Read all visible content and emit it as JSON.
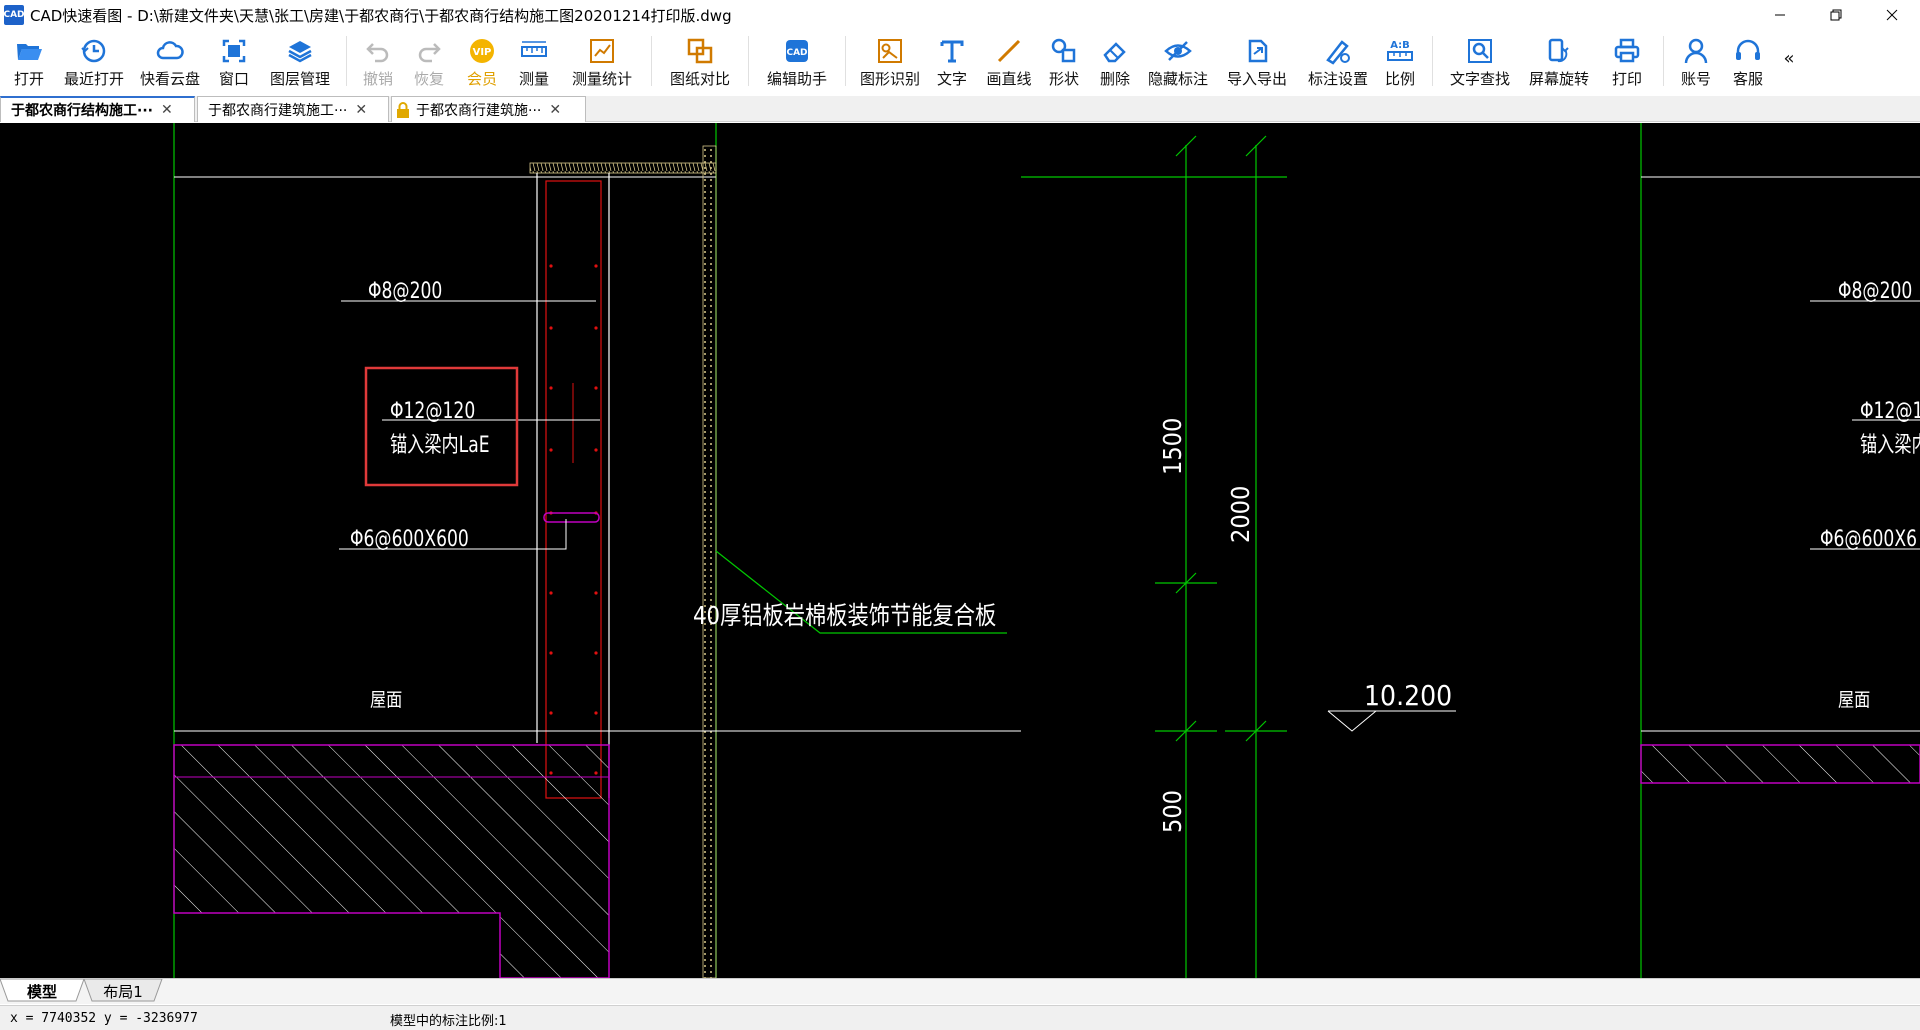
{
  "window": {
    "title": "CAD快速看图 - D:\\新建文件夹\\天慧\\张工\\房建\\于都农商行\\于都农商行结构施工图20201214打印版.dwg",
    "app_icon_text": "CAD"
  },
  "toolbar": {
    "items": [
      {
        "label": "打开",
        "icon": "folder-open-icon"
      },
      {
        "label": "最近打开",
        "icon": "recent-clock-icon"
      },
      {
        "label": "快看云盘",
        "icon": "cloud-icon"
      },
      {
        "label": "窗口",
        "icon": "window-icon"
      },
      {
        "label": "图层管理",
        "icon": "layers-icon"
      },
      {
        "label": "撤销",
        "icon": "undo-icon"
      },
      {
        "label": "恢复",
        "icon": "redo-icon"
      },
      {
        "label": "会员",
        "icon": "vip-icon"
      },
      {
        "label": "测量",
        "icon": "ruler-icon"
      },
      {
        "label": "测量统计",
        "icon": "measure-stats-icon"
      },
      {
        "label": "图纸对比",
        "icon": "compare-icon"
      },
      {
        "label": "编辑助手",
        "icon": "edit-assistant-icon"
      },
      {
        "label": "图形识别",
        "icon": "shape-recognize-icon"
      },
      {
        "label": "文字",
        "icon": "text-icon"
      },
      {
        "label": "画直线",
        "icon": "line-icon"
      },
      {
        "label": "形状",
        "icon": "shapes-icon"
      },
      {
        "label": "删除",
        "icon": "eraser-icon"
      },
      {
        "label": "隐藏标注",
        "icon": "hide-eye-icon"
      },
      {
        "label": "导入导出",
        "icon": "import-export-icon"
      },
      {
        "label": "标注设置",
        "icon": "annotation-settings-icon"
      },
      {
        "label": "比例",
        "icon": "scale-icon"
      },
      {
        "label": "文字查找",
        "icon": "text-search-icon"
      },
      {
        "label": "屏幕旋转",
        "icon": "rotate-screen-icon"
      },
      {
        "label": "打印",
        "icon": "printer-icon"
      },
      {
        "label": "账号",
        "icon": "user-icon"
      },
      {
        "label": "客服",
        "icon": "headset-icon"
      }
    ],
    "more_glyph": "«"
  },
  "doc_tabs": [
    {
      "label": "于都农商行结构施工···",
      "active": true
    },
    {
      "label": "于都农商行建筑施工···",
      "active": false
    },
    {
      "label": "于都农商行建筑施···",
      "active": false,
      "locked": true
    }
  ],
  "drawing": {
    "labels": {
      "rebar_phi8_left": "Φ8@200",
      "rebar_phi12_left": "Φ12@120",
      "anchor_left": "锚入梁内LaE",
      "rebar_phi6_left": "Φ6@600X600",
      "panel_note": "40厚铝板岩棉板装饰节能复合板",
      "roof_left": "屋面",
      "roof_right": "屋面",
      "dim_1500": "1500",
      "dim_2000": "2000",
      "dim_500": "500",
      "elevation": "10.200",
      "rebar_phi8_right": "Φ8@200",
      "rebar_phi12_right": "Φ12@1",
      "anchor_right": "锚入梁内l",
      "rebar_phi6_right": "Φ6@600X6"
    },
    "colors": {
      "background": "#000000",
      "wall_lines": "#ffffff",
      "green_lines": "#00c800",
      "rebar_red": "#e01010",
      "hatch_magenta": "#c000c0",
      "highlight_box": "#e03a3a"
    }
  },
  "layout_tabs": [
    {
      "label": "模型",
      "active": true
    },
    {
      "label": "布局1",
      "active": false
    }
  ],
  "status": {
    "coords": "x = 7740352  y = -3236977",
    "scale": "模型中的标注比例:1"
  }
}
